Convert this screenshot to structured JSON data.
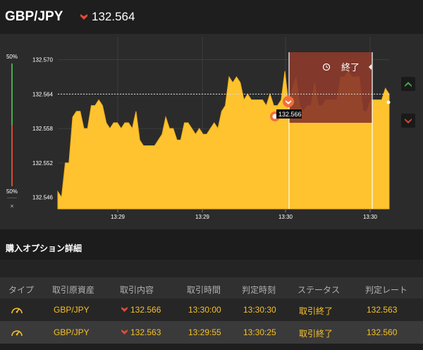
{
  "header": {
    "pair": "GBP/JPY",
    "direction": "down",
    "rate": "132.564",
    "arrow_color": "#e04a38"
  },
  "gauge": {
    "top_percent": "50%",
    "bottom_percent": "50%",
    "close_label": "×",
    "up_color": "#49a94d",
    "down_color": "#d44b35"
  },
  "chart_data": {
    "type": "area",
    "title": "",
    "xlabel": "",
    "ylabel": "",
    "ylim": [
      132.544,
      132.574
    ],
    "y_ticks": [
      "132.570",
      "132.564",
      "132.558",
      "132.552",
      "132.546"
    ],
    "x_ticks": [
      "13:29",
      "13:29",
      "13:30",
      "13:30"
    ],
    "fill_color": "#fec32f",
    "grid": true,
    "current_rate": "132.564",
    "expiry_label": "終了",
    "marker_label": "132.566",
    "series": [
      {
        "values": [
          132.547,
          132.546,
          132.552,
          132.552,
          132.56,
          132.561,
          132.561,
          132.558,
          132.558,
          132.562,
          132.562,
          132.563,
          132.562,
          132.559,
          132.558,
          132.559,
          132.559,
          132.558,
          132.559,
          132.559,
          132.558,
          132.561,
          132.556,
          132.555,
          132.555,
          132.555,
          132.555,
          132.556,
          132.557,
          132.56,
          132.558,
          132.558,
          132.556,
          132.556,
          132.559,
          132.559,
          132.558,
          132.557,
          132.558,
          132.557,
          132.557,
          132.558,
          132.559,
          132.558,
          132.561,
          132.562,
          132.567,
          132.566,
          132.567,
          132.566,
          132.563,
          132.564,
          132.563,
          132.563,
          132.563,
          132.563,
          132.562,
          132.564,
          132.562,
          132.562,
          132.563,
          132.568,
          132.562,
          132.565,
          132.567,
          132.562,
          132.561,
          132.562,
          132.562,
          132.566,
          132.562,
          132.562,
          132.563,
          132.563,
          132.563,
          132.563,
          132.567,
          132.567,
          132.568,
          132.567,
          132.567,
          132.567,
          132.561,
          132.561,
          132.563,
          132.563,
          132.563,
          132.563,
          132.565,
          132.564
        ]
      }
    ]
  },
  "section": {
    "title": "購入オプション詳細"
  },
  "table": {
    "columns": [
      "タイプ",
      "取引原資産",
      "取引内容",
      "取引時間",
      "判定時刻",
      "ステータス",
      "判定レート"
    ],
    "rows": [
      {
        "type_icon": "gauge-icon",
        "asset": "GBP/JPY",
        "direction": "down",
        "content": "132.566",
        "trade_time": "13:30:00",
        "judge_time": "13:30:30",
        "status": "取引終了",
        "judge_rate": "132.563"
      },
      {
        "type_icon": "gauge-icon",
        "asset": "GBP/JPY",
        "direction": "down",
        "content": "132.563",
        "trade_time": "13:29:55",
        "judge_time": "13:30:25",
        "status": "取引終了",
        "judge_rate": "132.560"
      }
    ]
  }
}
